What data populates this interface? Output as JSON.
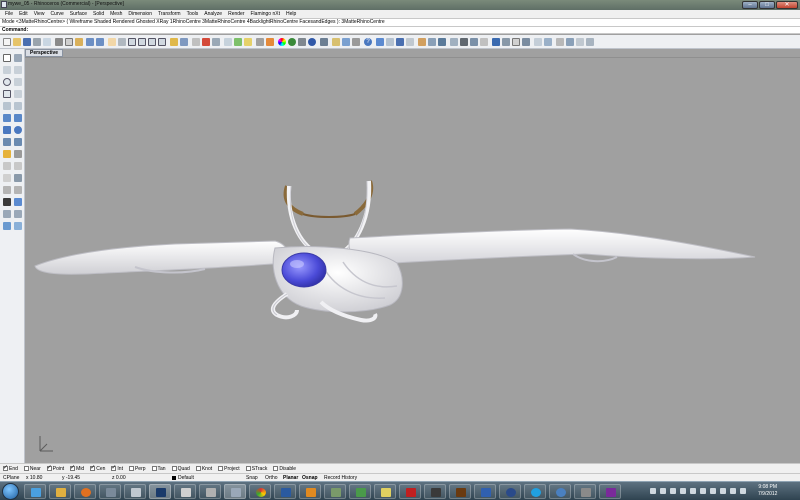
{
  "window": {
    "title": "mywe_05 - Rhinoceros (Commercial) - [Perspective]"
  },
  "menu": [
    "File",
    "Edit",
    "View",
    "Curve",
    "Surface",
    "Solid",
    "Mesh",
    "Dimension",
    "Transform",
    "Tools",
    "Analyze",
    "Render",
    "Flamingo nXt",
    "Help"
  ],
  "command_history": "Mode <3MatteRhinoCentre> ( Wireframe  Shaded  Rendered  Ghosted  XRay  1RhinoCentre  3MatteRhinoCentre  4BacklightRhinoCentre  FacesandEdges ): 3MatteRhinoCentre",
  "command_prompt": "Command:",
  "viewport": {
    "name": "Perspective",
    "axis_labels": [
      "x",
      "y",
      "z"
    ]
  },
  "osnaps": [
    {
      "label": "End",
      "checked": true
    },
    {
      "label": "Near",
      "checked": false
    },
    {
      "label": "Point",
      "checked": true
    },
    {
      "label": "Mid",
      "checked": true
    },
    {
      "label": "Cen",
      "checked": true
    },
    {
      "label": "Int",
      "checked": true
    },
    {
      "label": "Perp",
      "checked": false
    },
    {
      "label": "Tan",
      "checked": false
    },
    {
      "label": "Quad",
      "checked": false
    },
    {
      "label": "Knot",
      "checked": false
    },
    {
      "label": "Project",
      "checked": false
    },
    {
      "label": "STrack",
      "checked": false
    },
    {
      "label": "Disable",
      "checked": false
    }
  ],
  "status": {
    "cplane": "CPlane",
    "x": "x 10.80",
    "y": "y -19.45",
    "z": "z 0.00",
    "layer": "Default",
    "snap": "Snap",
    "ortho": "Ortho",
    "planar": "Planar",
    "osnap": "Osnap",
    "record_history": "Record History"
  },
  "taskbar": {
    "time": "9:08 PM",
    "date": "7/9/2012"
  },
  "colors": {
    "viewport_bg": "#a0a0a0",
    "canopy": "#4b4bd8",
    "taskbar": "#3a4d5a"
  }
}
